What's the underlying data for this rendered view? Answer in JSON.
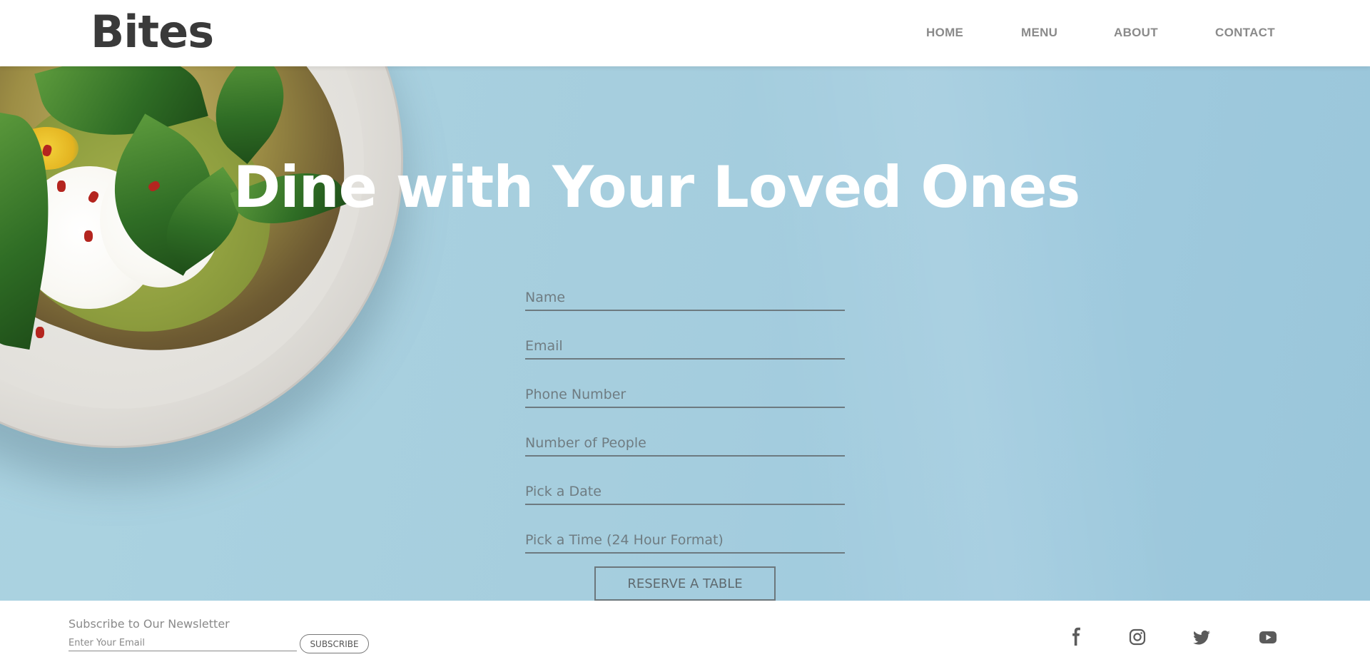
{
  "header": {
    "logo": "Bites",
    "nav": [
      {
        "label": "HOME"
      },
      {
        "label": "MENU"
      },
      {
        "label": "ABOUT"
      },
      {
        "label": "CONTACT"
      }
    ]
  },
  "hero": {
    "title": "Dine with Your Loved Ones",
    "form": {
      "fields": [
        {
          "placeholder": "Name",
          "value": ""
        },
        {
          "placeholder": "Email",
          "value": ""
        },
        {
          "placeholder": "Phone Number",
          "value": ""
        },
        {
          "placeholder": "Number of People",
          "value": ""
        },
        {
          "placeholder": "Pick a Date",
          "value": ""
        },
        {
          "placeholder": "Pick a Time (24 Hour Format)",
          "value": ""
        }
      ],
      "submit_label": "RESERVE A TABLE"
    },
    "background_color": "#a6cede"
  },
  "footer": {
    "newsletter_title": "Subscribe to Our Newsletter",
    "email_placeholder": "Enter Your Email",
    "subscribe_label": "SUBSCRIBE",
    "social": [
      "facebook-icon",
      "instagram-icon",
      "twitter-icon",
      "youtube-icon"
    ]
  }
}
